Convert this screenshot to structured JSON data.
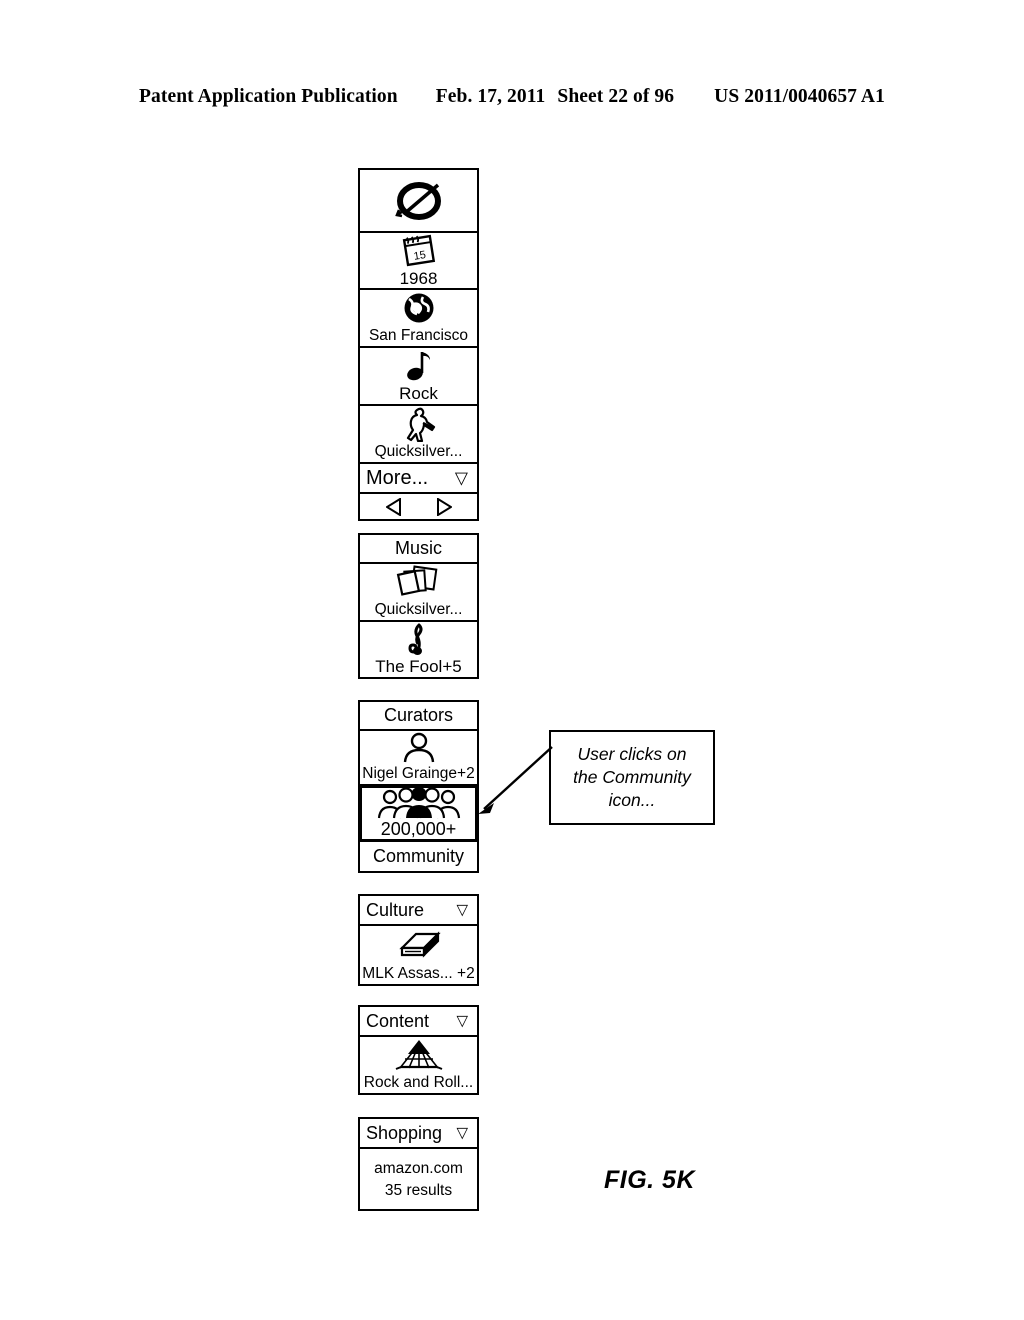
{
  "header": {
    "publication": "Patent Application Publication",
    "date": "Feb. 17, 2011",
    "sheet": "Sheet 22 of 96",
    "patent_number": "US 2011/0040657 A1"
  },
  "figure": {
    "label": "FIG. 5K"
  },
  "callout": {
    "line1": "User clicks on",
    "line2": "the Community",
    "line3": "icon...",
    "arrow": "arrow-pointing-left"
  },
  "panels": [
    {
      "name": "facets-panel",
      "rows": [
        {
          "icon": "no-entry-circle-icon",
          "label": ""
        },
        {
          "icon": "calendar-icon",
          "label": "1968"
        },
        {
          "icon": "globe-icon",
          "label": "San Francisco"
        },
        {
          "icon": "music-note-icon",
          "label": "Rock"
        },
        {
          "icon": "guitarist-icon",
          "label": "Quicksilver..."
        }
      ],
      "more": {
        "label": "More...",
        "caret": "▽"
      },
      "nav": {
        "prev_icon": "triangle-left-icon",
        "next_icon": "triangle-right-icon"
      }
    },
    {
      "name": "music-panel",
      "header": {
        "label": "Music",
        "caret": ""
      },
      "rows": [
        {
          "icon": "album-cards-icon",
          "label": "Quicksilver..."
        },
        {
          "icon": "treble-clef-icon",
          "label": "The Fool+5"
        }
      ]
    },
    {
      "name": "curators-panel",
      "header": {
        "label": "Curators",
        "caret": ""
      },
      "rows": [
        {
          "icon": "person-icon",
          "label": "Nigel Grainge+2",
          "selected": false
        },
        {
          "icon": "group-of-people-icon",
          "label": "200,000+",
          "selected": true
        }
      ],
      "footer": {
        "label": "Community"
      }
    },
    {
      "name": "culture-panel",
      "header": {
        "label": "Culture",
        "caret": "▽"
      },
      "rows": [
        {
          "icon": "book-icon",
          "label": "MLK Assas... +2"
        }
      ]
    },
    {
      "name": "content-panel",
      "header": {
        "label": "Content",
        "caret": "▽"
      },
      "rows": [
        {
          "icon": "hall-of-fame-building-icon",
          "label": "Rock and Roll..."
        }
      ]
    },
    {
      "name": "shopping-panel",
      "header": {
        "label": "Shopping",
        "caret": "▽"
      },
      "result": {
        "site": "amazon.com",
        "count": "35 results"
      }
    }
  ]
}
